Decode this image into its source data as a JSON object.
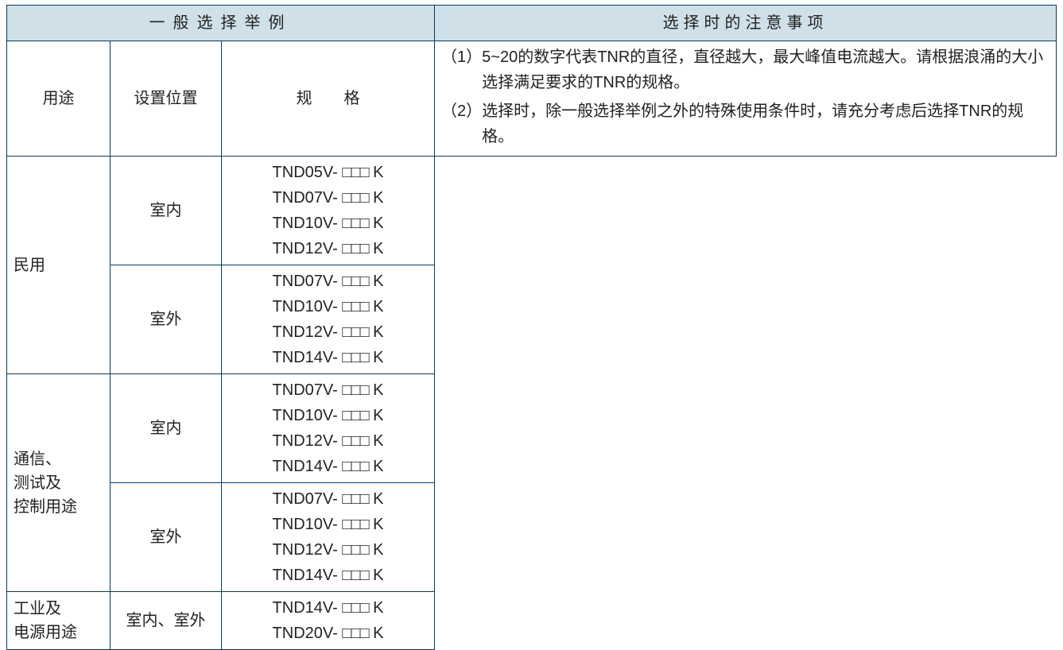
{
  "headers": {
    "left": "一般选择举例",
    "right": "选择时的注意事项",
    "usage": "用途",
    "location": "设置位置",
    "spec": "规　　格"
  },
  "rows": [
    {
      "usage": "民用",
      "groups": [
        {
          "location": "室内",
          "specs": [
            "TND05V-",
            "TND07V-",
            "TND10V-",
            "TND12V-"
          ]
        },
        {
          "location": "室外",
          "specs": [
            "TND07V-",
            "TND10V-",
            "TND12V-",
            "TND14V-"
          ]
        }
      ]
    },
    {
      "usage": "通信、\n测试及\n控制用途",
      "groups": [
        {
          "location": "室内",
          "specs": [
            "TND07V-",
            "TND10V-",
            "TND12V-",
            "TND14V-"
          ]
        },
        {
          "location": "室外",
          "specs": [
            "TND07V-",
            "TND10V-",
            "TND12V-",
            "TND14V-"
          ]
        }
      ]
    },
    {
      "usage": "工业及\n电源用途",
      "groups": [
        {
          "location": "室内、室外",
          "specs": [
            "TND14V-",
            "TND20V-"
          ]
        }
      ]
    }
  ],
  "spec_suffix_boxes": "□□□",
  "spec_suffix_k": " K",
  "notes": [
    {
      "num": "（1）",
      "text": "5~20的数字代表TNR的直径，直径越大，最大峰值电流越大。请根据浪涌的大小选择满足要求的TNR的规格。"
    },
    {
      "num": "（2）",
      "text": "选择时，除一般选择举例之外的特殊使用条件时，请充分考虑后选择TNR的规格。"
    }
  ]
}
